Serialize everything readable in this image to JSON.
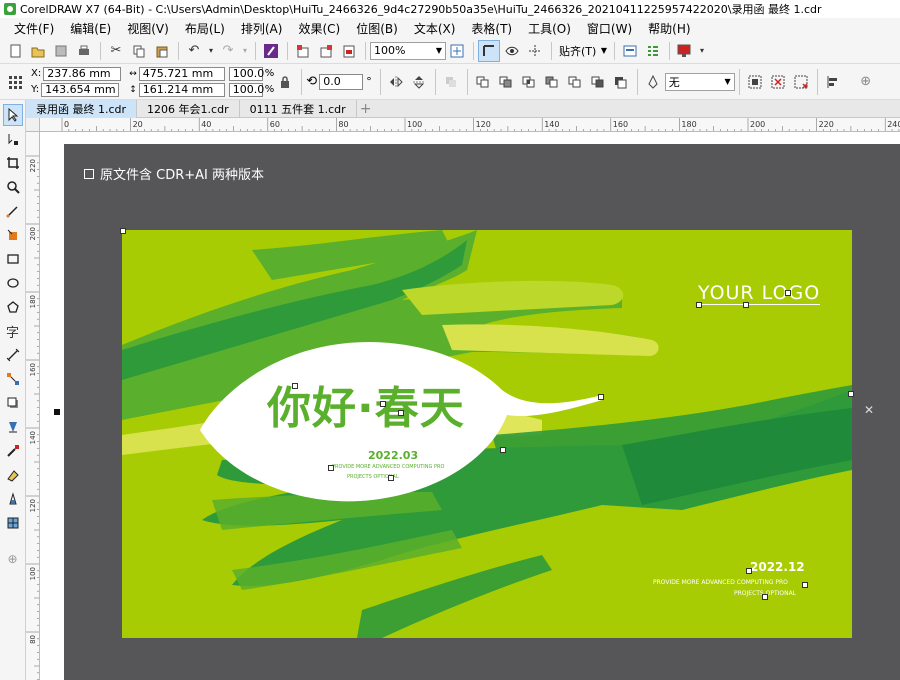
{
  "window": {
    "title": "CorelDRAW X7 (64-Bit) - C:\\Users\\Admin\\Desktop\\HuiTu_2466326_9d4c27290b50a35e\\HuiTu_2466326_20210411225957422020\\录用函 最终 1.cdr"
  },
  "menu": [
    "文件(F)",
    "编辑(E)",
    "视图(V)",
    "布局(L)",
    "排列(A)",
    "效果(C)",
    "位图(B)",
    "文本(X)",
    "表格(T)",
    "工具(O)",
    "窗口(W)",
    "帮助(H)"
  ],
  "toolbar": {
    "zoom": "100%",
    "snap_label": "贴齐(T)"
  },
  "property_bar": {
    "x": "237.86 mm",
    "y": "143.654 mm",
    "width": "475.721 mm",
    "height": "161.214 mm",
    "scale_x": "100.0",
    "scale_y": "100.0",
    "percent": "%",
    "rotation": "0.0",
    "degree": "°",
    "outline": "无"
  },
  "tabs": [
    "录用函 最终 1.cdr",
    "1206 年会1.cdr",
    "0111 五件套 1.cdr"
  ],
  "ruler": {
    "h_labels": [
      "0",
      "20",
      "40",
      "60",
      "80",
      "100",
      "120",
      "140",
      "160",
      "180",
      "200",
      "220",
      "240"
    ],
    "v_labels": [
      "220",
      "200",
      "180",
      "160",
      "140",
      "120",
      "100",
      "80"
    ]
  },
  "canvas": {
    "note": "原文件含 CDR+AI 两种版本",
    "logo": "YOUR LOGO",
    "headline": "你好·春天",
    "year_left": "2022.03",
    "small_left_1": "PROVIDE MORE ADVANCED COMPUTING PRO",
    "small_left_2": "PROJECTS OPTIONAL",
    "year_right": "2022.12",
    "small_right_1": "PROVIDE MORE ADVANCED COMPUTING PRO",
    "small_right_2": "PROJECTS OPTIONAL"
  },
  "colors": {
    "background_green": "#a8cc04",
    "dark_green": "#2f9a3a",
    "mid_green": "#5aaf2c",
    "light_yellow": "#e0e65a",
    "workspace_gray": "#565557"
  }
}
